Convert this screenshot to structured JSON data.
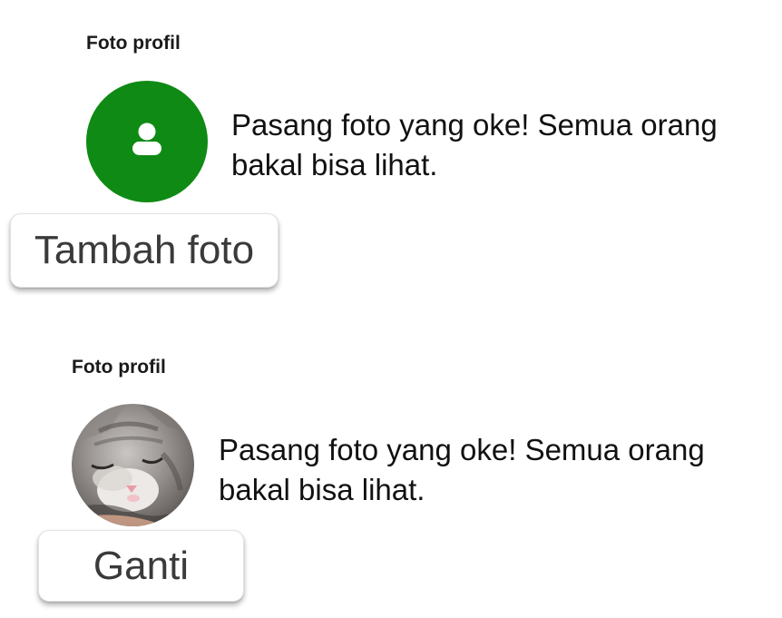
{
  "profile_empty": {
    "section_label": "Foto profil",
    "avatar_icon": "person-icon",
    "description": "Pasang foto yang oke! Semua orang bakal bisa lihat.",
    "button_label": "Tambah foto"
  },
  "profile_filled": {
    "section_label": "Foto profil",
    "avatar_image": "sleeping-cat-photo",
    "description": "Pasang foto yang oke! Semua orang bakal bisa lihat.",
    "button_label": "Ganti"
  },
  "colors": {
    "avatar_green": "#0f8a14",
    "text": "#111111",
    "button_text": "#3a3a3a"
  }
}
